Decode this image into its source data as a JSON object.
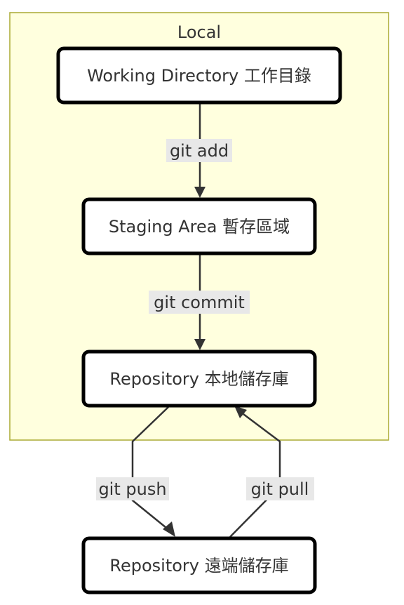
{
  "cluster": {
    "label": "Local"
  },
  "nodes": {
    "working_directory": "Working Directory 工作目錄",
    "staging_area": "Staging Area 暫存區域",
    "local_repository": "Repository 本地儲存庫",
    "remote_repository": "Repository 遠端儲存庫"
  },
  "edges": {
    "git_add": "git add",
    "git_commit": "git commit",
    "git_push": "git push",
    "git_pull": "git pull"
  },
  "colors": {
    "cluster_fill": "#ffffde",
    "cluster_stroke": "#aaaa33",
    "node_stroke": "#000000",
    "edge": "#333333",
    "edge_label_bg": "#e8e8e8"
  }
}
